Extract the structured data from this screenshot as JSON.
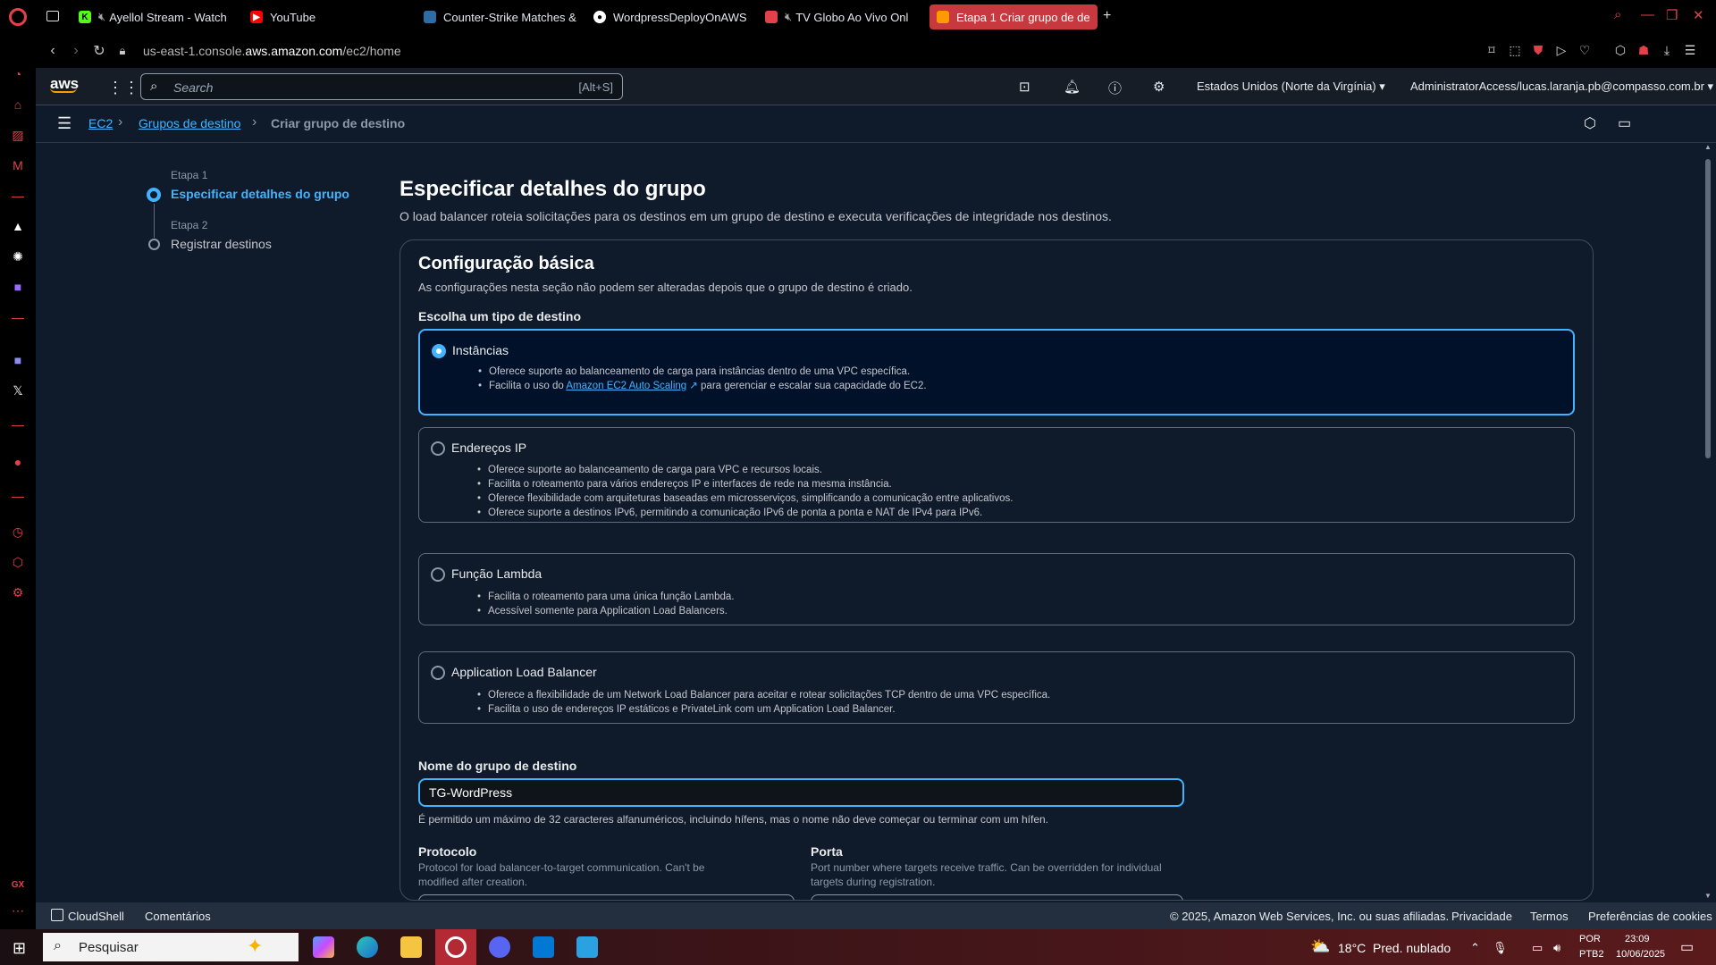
{
  "browser": {
    "tabs": [
      {
        "label": "Ayellol Stream - Watch",
        "icon": "kick-icon"
      },
      {
        "label": "YouTube",
        "icon": "youtube-icon"
      },
      {
        "label": "Counter-Strike Matches &",
        "icon": "hltv-icon"
      },
      {
        "label": "WordpressDeployOnAWS",
        "icon": "github-icon"
      },
      {
        "label": "TV Globo Ao Vivo Onl",
        "icon": "globo-icon"
      },
      {
        "label": "Etapa 1 Criar grupo de de",
        "icon": "aws-icon"
      }
    ],
    "new_tab": "+",
    "url_prefix": "us-east-1.console.",
    "url_domain": "aws.amazon.com",
    "url_path": "/ec2/home"
  },
  "aws_header": {
    "logo": "aws",
    "search_placeholder": "Search",
    "search_shortcut": "[Alt+S]",
    "region": "Estados Unidos (Norte da Virgínia) ▾",
    "account": "AdministratorAccess/lucas.laranja.pb@compasso.com.br ▾"
  },
  "breadcrumb": {
    "items": [
      "EC2",
      "Grupos de destino",
      "Criar grupo de destino"
    ]
  },
  "steps": [
    {
      "label": "Etapa 1",
      "title": "Especificar detalhes do grupo",
      "active": true
    },
    {
      "label": "Etapa 2",
      "title": "Registrar destinos",
      "active": false
    }
  ],
  "page": {
    "title": "Especificar detalhes do grupo",
    "description": "O load balancer roteia solicitações para os destinos em um grupo de destino e executa verificações de integridade nos destinos."
  },
  "basic_config": {
    "title": "Configuração básica",
    "description": "As configurações nesta seção não podem ser alteradas depois que o grupo de destino é criado.",
    "choose_type_label": "Escolha um tipo de destino",
    "options": [
      {
        "label": "Instâncias",
        "selected": true,
        "bullets": [
          "Oferece suporte ao balanceamento de carga para instâncias dentro de uma VPC específica."
        ],
        "bullet2_pre": "Facilita o uso do ",
        "bullet2_link": "Amazon EC2 Auto Scaling",
        "bullet2_post": " para gerenciar e escalar sua capacidade do EC2."
      },
      {
        "label": "Endereços IP",
        "selected": false,
        "bullets": [
          "Oferece suporte ao balanceamento de carga para VPC e recursos locais.",
          "Facilita o roteamento para vários endereços IP e interfaces de rede na mesma instância.",
          "Oferece flexibilidade com arquiteturas baseadas em microsserviços, simplificando a comunicação entre aplicativos.",
          "Oferece suporte a destinos IPv6, permitindo a comunicação IPv6 de ponta a ponta e NAT de IPv4 para IPv6."
        ]
      },
      {
        "label": "Função Lambda",
        "selected": false,
        "bullets": [
          "Facilita o roteamento para uma única função Lambda.",
          "Acessível somente para Application Load Balancers."
        ]
      },
      {
        "label": "Application Load Balancer",
        "selected": false,
        "bullets": [
          "Oferece a flexibilidade de um Network Load Balancer para aceitar e rotear solicitações TCP dentro de uma VPC específica.",
          "Facilita o uso de endereços IP estáticos e PrivateLink com um Application Load Balancer."
        ]
      }
    ],
    "name_label": "Nome do grupo de destino",
    "name_value": "TG-WordPress",
    "name_hint": "É permitido um máximo de 32 caracteres alfanuméricos, incluindo hífens, mas o nome não deve começar ou terminar com um hífen.",
    "protocol_label": "Protocolo",
    "protocol_desc": "Protocol for load balancer-to-target communication. Can't be modified after creation.",
    "port_label": "Porta",
    "port_desc": "Port number where targets receive traffic. Can be overridden for individual targets during registration."
  },
  "footer": {
    "cloudshell": "CloudShell",
    "feedback": "Comentários",
    "copyright": "© 2025, Amazon Web Services, Inc. ou suas afiliadas.",
    "privacy": "Privacidade",
    "terms": "Termos",
    "cookies": "Preferências de cookies"
  },
  "taskbar": {
    "search": "Pesquisar",
    "weather_temp": "18°C",
    "weather_desc": "Pred. nublado",
    "lang1": "POR",
    "lang2": "PTB2",
    "time": "23:09",
    "date": "10/06/2025"
  },
  "colors": {
    "accent": "#42b4ff",
    "aws_orange": "#ff9900",
    "opera_red": "#e2414b"
  }
}
